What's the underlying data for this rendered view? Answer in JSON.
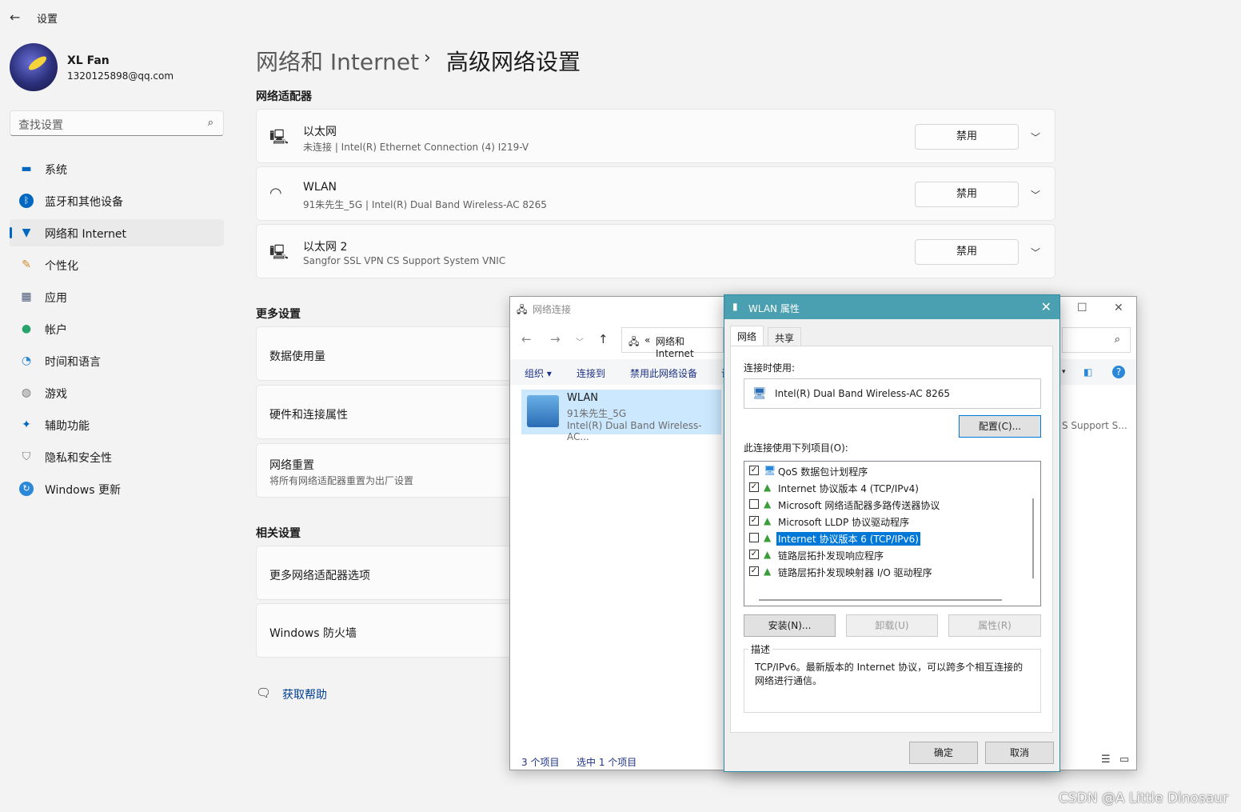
{
  "app": {
    "title": "设置"
  },
  "profile": {
    "name": "XL Fan",
    "email": "1320125898@qq.com"
  },
  "search": {
    "placeholder": "查找设置"
  },
  "nav": [
    {
      "label": "系统",
      "icon": "monitor-icon"
    },
    {
      "label": "蓝牙和其他设备",
      "icon": "bluetooth-icon"
    },
    {
      "label": "网络和 Internet",
      "icon": "wifi-icon",
      "active": true
    },
    {
      "label": "个性化",
      "icon": "brush-icon"
    },
    {
      "label": "应用",
      "icon": "apps-icon"
    },
    {
      "label": "帐户",
      "icon": "person-icon"
    },
    {
      "label": "时间和语言",
      "icon": "clock-globe-icon"
    },
    {
      "label": "游戏",
      "icon": "gamepad-icon"
    },
    {
      "label": "辅助功能",
      "icon": "accessibility-icon"
    },
    {
      "label": "隐私和安全性",
      "icon": "shield-icon"
    },
    {
      "label": "Windows 更新",
      "icon": "update-icon"
    }
  ],
  "header": {
    "parent": "网络和 Internet",
    "separator": "›",
    "current": "高级网络设置"
  },
  "adapters": {
    "title": "网络适配器",
    "items": [
      {
        "name": "以太网",
        "detail": "未连接 | Intel(R) Ethernet Connection (4) I219-V",
        "button": "禁用",
        "icon": "ethernet-icon"
      },
      {
        "name": "WLAN",
        "detail": "91朱先生_5G | Intel(R) Dual Band Wireless-AC 8265",
        "button": "禁用",
        "icon": "wifi-icon"
      },
      {
        "name": "以太网 2",
        "detail": "Sangfor SSL VPN CS Support System VNIC",
        "button": "禁用",
        "icon": "ethernet-icon"
      }
    ]
  },
  "more": {
    "title": "更多设置",
    "items": [
      {
        "name": "数据使用量"
      },
      {
        "name": "硬件和连接属性"
      },
      {
        "name": "网络重置",
        "detail": "将所有网络适配器重置为出厂设置"
      }
    ]
  },
  "related": {
    "title": "相关设置",
    "items": [
      {
        "name": "更多网络适配器选项"
      },
      {
        "name": "Windows 防火墙"
      }
    ]
  },
  "help": {
    "label": "获取帮助"
  },
  "netconn": {
    "title": "网络连接",
    "address_prefix": "«",
    "address": "网络和 Internet",
    "toolbar": [
      "组织 ▾",
      "连接到",
      "禁用此网络设备",
      "诊"
    ],
    "item": {
      "name": "WLAN",
      "ssid": "91朱先生_5G",
      "adapter": "Intel(R) Dual Band Wireless-AC..."
    },
    "right_item_partial": "S Support S...",
    "status": {
      "count": "3 个项目",
      "selected": "选中 1 个项目"
    }
  },
  "dialog": {
    "title": "WLAN 属性",
    "tabs": [
      "网络",
      "共享"
    ],
    "connect_using_label": "连接时使用:",
    "adapter": "Intel(R) Dual Band Wireless-AC 8265",
    "configure_button": "配置(C)...",
    "items_label": "此连接使用下列项目(O):",
    "items": [
      {
        "label": "QoS 数据包计划程序",
        "checked": true
      },
      {
        "label": "Internet 协议版本 4 (TCP/IPv4)",
        "checked": true
      },
      {
        "label": "Microsoft 网络适配器多路传送器协议",
        "checked": false
      },
      {
        "label": "Microsoft LLDP 协议驱动程序",
        "checked": true
      },
      {
        "label": "Internet 协议版本 6 (TCP/IPv6)",
        "checked": false,
        "selected": true
      },
      {
        "label": "链路层拓扑发现响应程序",
        "checked": true
      },
      {
        "label": "链路层拓扑发现映射器 I/O 驱动程序",
        "checked": true
      }
    ],
    "install_button": "安装(N)...",
    "uninstall_button": "卸载(U)",
    "properties_button": "属性(R)",
    "description_title": "描述",
    "description": "TCP/IPv6。最新版本的 Internet 协议，可以跨多个相互连接的网络进行通信。",
    "ok_button": "确定",
    "cancel_button": "取消"
  },
  "watermark": "CSDN @A Little Dinosaur"
}
